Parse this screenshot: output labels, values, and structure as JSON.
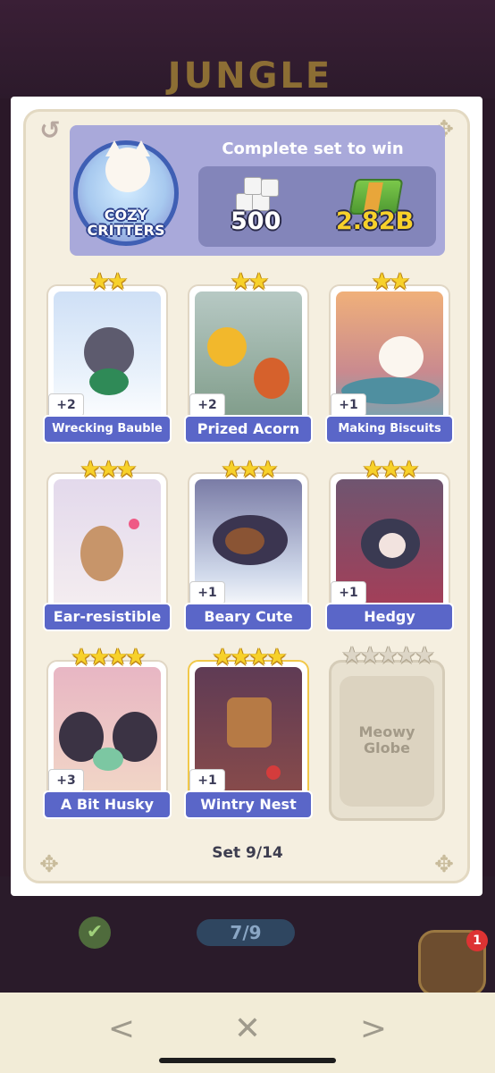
{
  "set": {
    "name": "COZY CRITTERS",
    "header_title": "Complete set to win",
    "rewards": {
      "dice": "500",
      "cash": "2.82B"
    },
    "set_label": "Set 9/14"
  },
  "stickers": [
    {
      "name": "Wrecking Bauble",
      "stars": "★★",
      "count": "+2"
    },
    {
      "name": "Prized Acorn",
      "stars": "★★",
      "count": "+2"
    },
    {
      "name": "Making Biscuits",
      "stars": "★★",
      "count": "+1"
    },
    {
      "name": "Ear-resistible",
      "stars": "★★★",
      "count": ""
    },
    {
      "name": "Beary Cute",
      "stars": "★★★",
      "count": "+1"
    },
    {
      "name": "Hedgy",
      "stars": "★★★",
      "count": "+1"
    },
    {
      "name": "A Bit Husky",
      "stars": "★★★★",
      "count": "+3"
    },
    {
      "name": "Wintry Nest",
      "stars": "★★★★",
      "count": "+1"
    },
    {
      "name": "Meowy Globe",
      "stars": "★★★★★",
      "count": "",
      "locked": true
    }
  ],
  "background": {
    "title_fragment": "JUNGLE",
    "progress": "7/9",
    "notification_count": "1"
  },
  "nav": {
    "back": "<",
    "close": "✕",
    "forward": ">"
  },
  "icons": {
    "history": "history-icon",
    "check": "check-icon",
    "dice": "dice-icon",
    "cash": "cash-stack-icon"
  },
  "colors": {
    "banner": "#5a66c8",
    "header": "#a9a9da",
    "star": "#f7d12a"
  }
}
